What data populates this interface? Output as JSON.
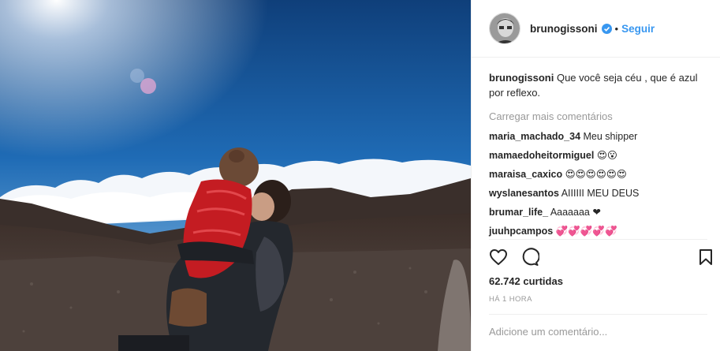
{
  "post": {
    "username": "brunogissoni",
    "dot": "•",
    "follow_label": "Seguir",
    "caption_user": "brunogissoni",
    "caption_text": " Que você seja céu , que é azul por reflexo.",
    "load_more": "Carregar mais comentários",
    "comments": [
      {
        "user": "maria_machado_34",
        "text": " Meu shipper"
      },
      {
        "user": "mamaedoheitormiguel",
        "text": " 😍😮"
      },
      {
        "user": "maraisa_caxico",
        "text": " 😍😍😍😍😍😍"
      },
      {
        "user": "wyslanesantos",
        "text": " AIIIIII MEU DEUS"
      },
      {
        "user": "brumar_life_",
        "text": " Aaaaaaa ❤"
      },
      {
        "user": "juuhpcampos",
        "text": " 💞💞💞💞💞"
      }
    ],
    "likes": "62.742 curtidas",
    "timestamp": "HÁ 1 HORA",
    "add_comment_placeholder": "Adicione um comentário..."
  },
  "icons": {
    "like": "heart-icon",
    "comment": "comment-bubble-icon",
    "save": "bookmark-icon",
    "verified": "verified-badge-icon"
  },
  "colors": {
    "accent": "#3897f0",
    "text": "#262626",
    "muted": "#999999",
    "divider": "#efefef"
  }
}
